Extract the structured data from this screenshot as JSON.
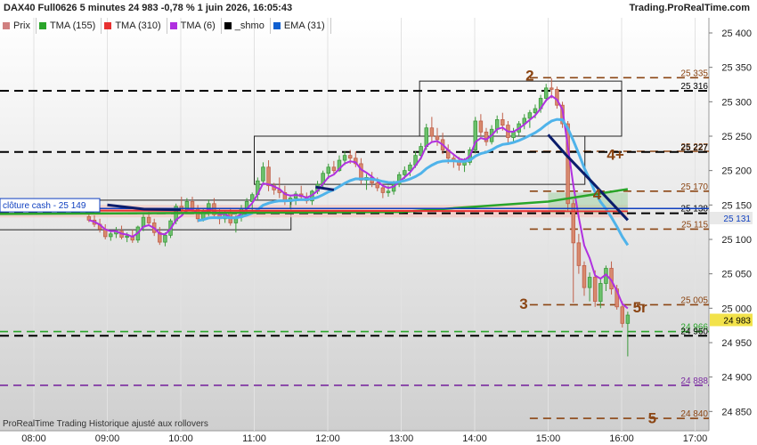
{
  "header": {
    "title": "DAX40 Full0626 5 minutes 24 983 -0,78 % 1 juin 2026, 16:05:43",
    "brand": "Trading.ProRealTime.com"
  },
  "legend": [
    {
      "label": "Prix",
      "color": "#d08080"
    },
    {
      "label": "TMA (155)",
      "color": "#2aa52a"
    },
    {
      "label": "TMA (310)",
      "color": "#e83030"
    },
    {
      "label": "TMA (6)",
      "color": "#b030e0"
    },
    {
      "label": "_shmo",
      "color": "#000000"
    },
    {
      "label": "EMA (31)",
      "color": "#1060d0"
    }
  ],
  "footer": "ProRealTime Trading  Historique ajusté aux rollovers",
  "cloture_label": "clôture cash -  25 149",
  "chart_data": {
    "type": "candlestick",
    "x_ticks": [
      "08:00",
      "09:00",
      "10:00",
      "11:00",
      "12:00",
      "13:00",
      "14:00",
      "15:00",
      "16:00",
      "17:00"
    ],
    "y_ticks": [
      25400,
      25350,
      25300,
      25250,
      25200,
      25150,
      25100,
      25050,
      25000,
      24950,
      24900,
      24850
    ],
    "y_tick_labels": [
      "25 400",
      "25 350",
      "25 300",
      "25 250",
      "25 200",
      "25 150",
      "25 100",
      "25 050",
      "25 000",
      "24 950",
      "24 900",
      "24 850"
    ],
    "ylim": [
      24815,
      25430
    ],
    "price_levels": [
      {
        "value": 25335,
        "label": "25 335",
        "color": "#8b4513",
        "style": "dash"
      },
      {
        "value": 25316,
        "label": "25 316",
        "color": "#000000",
        "style": "dash"
      },
      {
        "value": 25228,
        "label": "25 227",
        "color": "#8b4513",
        "style": "dash"
      },
      {
        "value": 25227,
        "label": "25 227",
        "color": "#000000",
        "style": "dash"
      },
      {
        "value": 25170,
        "label": "25 170",
        "color": "#8b4513",
        "style": "dash"
      },
      {
        "value": 25138,
        "label": "25 138",
        "color": "#000000",
        "style": "dash"
      },
      {
        "value": 25115,
        "label": "25 115",
        "color": "#8b4513",
        "style": "dash"
      },
      {
        "value": 25005,
        "label": "25 005",
        "color": "#8b4513",
        "style": "dash"
      },
      {
        "value": 24966,
        "label": "24 966",
        "color": "#2aa52a",
        "style": "dash"
      },
      {
        "value": 24960,
        "label": "24 960",
        "color": "#000000",
        "style": "dash"
      },
      {
        "value": 24888,
        "label": "24 888",
        "color": "#7a2aa0",
        "style": "dash"
      },
      {
        "value": 24840,
        "label": "24 840",
        "color": "#8b4513",
        "style": "dash"
      }
    ],
    "current_price": {
      "value": 24983,
      "label": "24 983"
    },
    "ema_price": {
      "value": 25131,
      "label": "25 131"
    },
    "cloture": {
      "value": 25149
    },
    "wave_labels": [
      {
        "text": "2",
        "time": "14:45",
        "price": 25340
      },
      {
        "text": "4+",
        "time": "15:55",
        "price": 25225
      },
      {
        "text": "4",
        "time": "15:40",
        "price": 25167
      },
      {
        "text": "3",
        "time": "14:40",
        "price": 25008
      },
      {
        "text": "5r",
        "time": "16:15",
        "price": 25003
      },
      {
        "text": "5",
        "time": "16:25",
        "price": 24842
      }
    ],
    "boxes": [
      {
        "t1": "07:00",
        "t2": "11:30",
        "p1": 25157,
        "p2": 25114
      },
      {
        "t1": "11:00",
        "t2": "15:30",
        "p1": 25250,
        "p2": 25180
      },
      {
        "t1": "13:15",
        "t2": "16:00",
        "p1": 25330,
        "p2": 25250
      }
    ],
    "candles": [
      [
        25133,
        25141,
        25125,
        25128
      ],
      [
        25128,
        25135,
        25118,
        25122
      ],
      [
        25122,
        25130,
        25110,
        25115
      ],
      [
        25115,
        25122,
        25100,
        25104
      ],
      [
        25104,
        25112,
        25098,
        25108
      ],
      [
        25108,
        25118,
        25102,
        25112
      ],
      [
        25112,
        25120,
        25100,
        25103
      ],
      [
        25103,
        25110,
        25096,
        25105
      ],
      [
        25105,
        25114,
        25095,
        25099
      ],
      [
        25099,
        25120,
        25095,
        25118
      ],
      [
        25118,
        25136,
        25112,
        25132
      ],
      [
        25132,
        25140,
        25120,
        25124
      ],
      [
        25124,
        25130,
        25105,
        25110
      ],
      [
        25110,
        25118,
        25092,
        25096
      ],
      [
        25096,
        25110,
        25090,
        25106
      ],
      [
        25106,
        25130,
        25102,
        25127
      ],
      [
        25127,
        25152,
        25122,
        25148
      ],
      [
        25148,
        25162,
        25138,
        25143
      ],
      [
        25143,
        25160,
        25138,
        25155
      ],
      [
        25155,
        25162,
        25140,
        25144
      ],
      [
        25144,
        25150,
        25125,
        25130
      ],
      [
        25130,
        25145,
        25126,
        25140
      ],
      [
        25140,
        25158,
        25134,
        25152
      ],
      [
        25152,
        25160,
        25130,
        25136
      ],
      [
        25136,
        25145,
        25122,
        25130
      ],
      [
        25130,
        25142,
        25124,
        25138
      ],
      [
        25138,
        25146,
        25120,
        25124
      ],
      [
        25124,
        25135,
        25110,
        25132
      ],
      [
        25132,
        25150,
        25126,
        25145
      ],
      [
        25145,
        25160,
        25138,
        25155
      ],
      [
        25155,
        25168,
        25140,
        25165
      ],
      [
        25165,
        25190,
        25158,
        25185
      ],
      [
        25185,
        25212,
        25180,
        25205
      ],
      [
        25205,
        25215,
        25170,
        25178
      ],
      [
        25178,
        25182,
        25165,
        25172
      ],
      [
        25172,
        25190,
        25160,
        25168
      ],
      [
        25168,
        25178,
        25150,
        25155
      ],
      [
        25155,
        25165,
        25145,
        25160
      ],
      [
        25160,
        25170,
        25150,
        25166
      ],
      [
        25166,
        25178,
        25158,
        25162
      ],
      [
        25162,
        25168,
        25152,
        25156
      ],
      [
        25156,
        25172,
        25150,
        25170
      ],
      [
        25170,
        25185,
        25166,
        25180
      ],
      [
        25180,
        25200,
        25176,
        25196
      ],
      [
        25196,
        25210,
        25188,
        25205
      ],
      [
        25205,
        25214,
        25196,
        25200
      ],
      [
        25200,
        25222,
        25198,
        25215
      ],
      [
        25215,
        25228,
        25208,
        25222
      ],
      [
        25222,
        25230,
        25210,
        25218
      ],
      [
        25218,
        25228,
        25205,
        25210
      ],
      [
        25210,
        25218,
        25180,
        25186
      ],
      [
        25186,
        25195,
        25172,
        25190
      ],
      [
        25190,
        25198,
        25176,
        25182
      ],
      [
        25182,
        25190,
        25170,
        25175
      ],
      [
        25175,
        25180,
        25160,
        25168
      ],
      [
        25168,
        25178,
        25162,
        25170
      ],
      [
        25170,
        25185,
        25165,
        25180
      ],
      [
        25180,
        25198,
        25176,
        25194
      ],
      [
        25194,
        25206,
        25188,
        25200
      ],
      [
        25200,
        25212,
        25192,
        25208
      ],
      [
        25208,
        25228,
        25204,
        25222
      ],
      [
        25222,
        25240,
        25216,
        25235
      ],
      [
        25235,
        25268,
        25230,
        25262
      ],
      [
        25262,
        25278,
        25242,
        25250
      ],
      [
        25250,
        25262,
        25236,
        25245
      ],
      [
        25245,
        25255,
        25224,
        25230
      ],
      [
        25230,
        25238,
        25210,
        25218
      ],
      [
        25218,
        25225,
        25204,
        25214
      ],
      [
        25214,
        25220,
        25200,
        25208
      ],
      [
        25208,
        25218,
        25198,
        25212
      ],
      [
        25212,
        25234,
        25208,
        25230
      ],
      [
        25230,
        25278,
        25225,
        25272
      ],
      [
        25272,
        25282,
        25250,
        25256
      ],
      [
        25256,
        25262,
        25236,
        25242
      ],
      [
        25242,
        25266,
        25238,
        25260
      ],
      [
        25260,
        25280,
        25254,
        25274
      ],
      [
        25274,
        25284,
        25258,
        25266
      ],
      [
        25266,
        25272,
        25240,
        25248
      ],
      [
        25248,
        25262,
        25242,
        25256
      ],
      [
        25256,
        25272,
        25250,
        25268
      ],
      [
        25268,
        25282,
        25260,
        25276
      ],
      [
        25276,
        25288,
        25262,
        25284
      ],
      [
        25284,
        25296,
        25276,
        25290
      ],
      [
        25290,
        25310,
        25284,
        25305
      ],
      [
        25305,
        25326,
        25300,
        25320
      ],
      [
        25320,
        25334,
        25305,
        25318
      ],
      [
        25318,
        25322,
        25290,
        25295
      ],
      [
        25295,
        25300,
        25262,
        25268
      ],
      [
        25268,
        25272,
        25140,
        25152
      ],
      [
        25152,
        25158,
        25008,
        25095
      ],
      [
        25095,
        25108,
        25050,
        25062
      ],
      [
        25062,
        25068,
        25018,
        25030
      ],
      [
        25030,
        25052,
        25010,
        25045
      ],
      [
        25045,
        25055,
        25002,
        25010
      ],
      [
        25010,
        25042,
        25000,
        25036
      ],
      [
        25036,
        25062,
        25025,
        25058
      ],
      [
        25058,
        25068,
        25020,
        25028
      ],
      [
        25028,
        25034,
        24998,
        25002
      ],
      [
        25002,
        25010,
        24972,
        24978
      ],
      [
        24978,
        24995,
        24930,
        24990
      ]
    ],
    "series": [
      {
        "name": "TMA (155)",
        "color": "#2aa52a"
      },
      {
        "name": "TMA (310)",
        "color": "#e83030"
      },
      {
        "name": "TMA (6)",
        "color": "#b030e0"
      },
      {
        "name": "_shmo",
        "color": "#000000"
      },
      {
        "name": "EMA (31)",
        "color": "#1060d0"
      }
    ]
  }
}
